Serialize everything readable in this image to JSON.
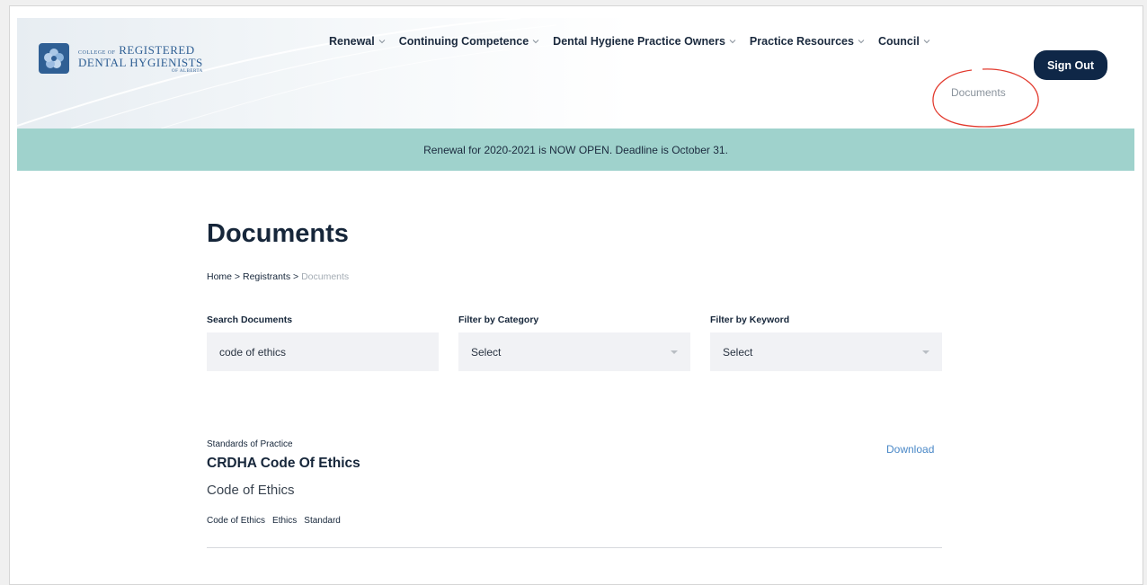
{
  "header": {
    "logo": {
      "line1_small": "COLLEGE OF",
      "line1": "REGISTERED",
      "line2": "DENTAL HYGIENISTS",
      "line3": "OF ALBERTA"
    },
    "nav": [
      {
        "label": "Renewal"
      },
      {
        "label": "Continuing Competence"
      },
      {
        "label": "Dental Hygiene Practice Owners"
      },
      {
        "label": "Practice Resources"
      },
      {
        "label": "Council"
      }
    ],
    "sign_out": "Sign Out",
    "submenu_documents": "Documents"
  },
  "banner": {
    "text": "Renewal for 2020-2021 is NOW OPEN. Deadline is October 31."
  },
  "page": {
    "title": "Documents",
    "breadcrumb": {
      "home": "Home",
      "sep": " > ",
      "registrants": "Registrants",
      "current": "Documents"
    }
  },
  "filters": {
    "search_label": "Search Documents",
    "search_value": "code of ethics",
    "category_label": "Filter by Category",
    "category_value": "Select",
    "keyword_label": "Filter by Keyword",
    "keyword_value": "Select"
  },
  "results": [
    {
      "category": "Standards of Practice",
      "title": "CRDHA Code Of Ethics",
      "description": "Code of Ethics",
      "tags": [
        "Code of Ethics",
        "Ethics",
        "Standard"
      ],
      "download": "Download"
    }
  ],
  "colors": {
    "navy": "#0f2747",
    "banner": "#9fd2cc",
    "link": "#4a88c7",
    "annotation": "#e23a2e"
  }
}
